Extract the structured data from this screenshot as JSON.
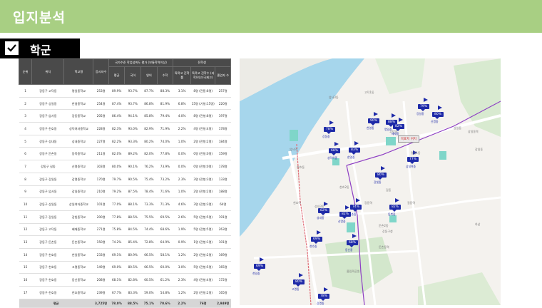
{
  "page": {
    "title": "입지분석",
    "section": "학군"
  },
  "table": {
    "head_top": [
      "순위",
      "위치",
      "학교명",
      "응시자수",
      "국가수준 학업성취도 평가 (보통학력이상)",
      "전학생",
      "",
      "",
      "",
      "진학률"
    ],
    "col_num": "순위",
    "col_loc": "위치",
    "col_school": "학교명",
    "col_takers": "응시자수",
    "col_group": "국가수준 학업성취도 평가 (보통학력이상)",
    "col_transfer": "전학생",
    "sub": [
      "평균",
      "국어",
      "영어",
      "수학",
      "특목고 진학률",
      "특목고 진학수 (과학/외고/국제고)",
      "졸업자 수"
    ],
    "rows": [
      {
        "n": "1",
        "loc": "강동구 고덕동",
        "school": "명일중학교",
        "takers": "253명",
        "avg": "89.9%",
        "kor": "93.7%",
        "eng": "87.7%",
        "math": "88.3%",
        "rate": "3.1%",
        "adv": "8명 (전통:8명)",
        "grad": "257명"
      },
      {
        "n": "2",
        "loc": "강동구 상일동",
        "school": "한영중학교",
        "takers": "254명",
        "avg": "87.4%",
        "kor": "93.7%",
        "eng": "86.8%",
        "math": "81.9%",
        "rate": "6.8%",
        "adv": "15명 (기형:15명)",
        "grad": "220명"
      },
      {
        "n": "3",
        "loc": "강동구 암사동",
        "school": "강동중학교",
        "takers": "205명",
        "avg": "86.4%",
        "kor": "94.1%",
        "eng": "85.8%",
        "math": "79.4%",
        "rate": "4.0%",
        "adv": "8명 (전형:8명)",
        "grad": "197명"
      },
      {
        "n": "4",
        "loc": "강동구 천호동",
        "school": "성덕여자중학교",
        "takers": "228명",
        "avg": "82.3%",
        "kor": "93.0%",
        "eng": "82.9%",
        "math": "71.9%",
        "rate": "2.2%",
        "adv": "4명 (전형:4명)",
        "grad": "178명"
      },
      {
        "n": "5",
        "loc": "강동구 성내동",
        "school": "성내중학교",
        "takers": "227명",
        "avg": "82.2%",
        "kor": "93.3%",
        "eng": "80.2%",
        "math": "74.0%",
        "rate": "1.0%",
        "adv": "2명 (전형:2명)",
        "grad": "184명"
      },
      {
        "n": "6",
        "loc": "강동구 둔촌동",
        "school": "동북중학교",
        "takers": "211명",
        "avg": "82.0%",
        "kor": "89.2%",
        "eng": "82.0%",
        "math": "77.8%",
        "rate": "0.0%",
        "adv": "0명 (전형:0명)",
        "grad": "159명"
      },
      {
        "n": "7",
        "loc": "강동구 길동",
        "school": "신명중학교",
        "takers": "303명",
        "avg": "80.0%",
        "kor": "90.1%",
        "eng": "76.2%",
        "math": "73.9%",
        "rate": "0.0%",
        "adv": "0명 (전형:0명)",
        "grad": "178명"
      },
      {
        "n": "8",
        "loc": "강동구 강일동",
        "school": "강명중학교",
        "takers": "170명",
        "avg": "79.7%",
        "kor": "90.5%",
        "eng": "75.4%",
        "math": "73.2%",
        "rate": "2.3%",
        "adv": "3명 (전형:3명)",
        "grad": "133명"
      },
      {
        "n": "9",
        "loc": "강동구 암사동",
        "school": "강일중학교",
        "takers": "210명",
        "avg": "79.2%",
        "kor": "87.5%",
        "eng": "78.4%",
        "math": "71.6%",
        "rate": "1.0%",
        "adv": "2명 (전형:2명)",
        "grad": "188명"
      },
      {
        "n": "10",
        "loc": "강동구 상일동",
        "school": "상일여자중학교",
        "takers": "101명",
        "avg": "77.0%",
        "kor": "88.1%",
        "eng": "73.3%",
        "math": "71.3%",
        "rate": "4.6%",
        "adv": "3명 (전형:3명)",
        "grad": "64명"
      },
      {
        "n": "11",
        "loc": "강동구 강일동",
        "school": "강빛중학교",
        "takers": "200명",
        "avg": "77.8%",
        "kor": "88.5%",
        "eng": "75.5%",
        "math": "69.5%",
        "rate": "2.6%",
        "adv": "5명 (전형:5명)",
        "grad": "191명"
      },
      {
        "n": "12",
        "loc": "강동구 고덕동",
        "school": "배재중학교",
        "takers": "271명",
        "avg": "75.8%",
        "kor": "84.5%",
        "eng": "74.4%",
        "math": "68.6%",
        "rate": "1.9%",
        "adv": "5명 (전형:5명)",
        "grad": "263명"
      },
      {
        "n": "13",
        "loc": "강동구 둔촌동",
        "school": "둔촌중학교",
        "takers": "150명",
        "avg": "74.2%",
        "kor": "85.4%",
        "eng": "72.8%",
        "math": "64.9%",
        "rate": "0.9%",
        "adv": "1명 (전형:1명)",
        "grad": "101명"
      },
      {
        "n": "14",
        "loc": "강동구 천호동",
        "school": "천일중학교",
        "takers": "233명",
        "avg": "69.1%",
        "kor": "80.9%",
        "eng": "66.5%",
        "math": "58.1%",
        "rate": "1.2%",
        "adv": "2명 (전형:2명)",
        "grad": "169명"
      },
      {
        "n": "15",
        "loc": "강동구 천호동",
        "school": "고명중학교",
        "takers": "149명",
        "avg": "69.0%",
        "kor": "80.5%",
        "eng": "66.5%",
        "math": "60.0%",
        "rate": "3.0%",
        "adv": "5명 (전형:5명)",
        "grad": "165명"
      },
      {
        "n": "16",
        "loc": "강동구 천호동",
        "school": "동신중학교",
        "takers": "208명",
        "avg": "68.1%",
        "kor": "82.8%",
        "eng": "60.5%",
        "math": "61.2%",
        "rate": "2.3%",
        "adv": "4명 (전형:4명)",
        "grad": "172명"
      },
      {
        "n": "17",
        "loc": "강동구 천호동",
        "school": "천호중학교",
        "takers": "239명",
        "avg": "67.7%",
        "kor": "83.3%",
        "eng": "59.0%",
        "math": "54.8%",
        "rate": "1.2%",
        "adv": "2명 (전형:2명)",
        "grad": "165명"
      }
    ],
    "avg_row": {
      "label": "평균",
      "takers": "3,725명",
      "avg": "78.0%",
      "kor": "88.5%",
      "eng": "75.1%",
      "math": "70.6%",
      "rate": "2.2%",
      "adv": "76명",
      "grad": "2,949명"
    }
  },
  "map": {
    "target_label": "목표지 위치",
    "markers": [
      {
        "pct": "78%",
        "name": "강동중"
      },
      {
        "pct": "90%",
        "name": "한영중"
      },
      {
        "pct": "79%",
        "name": "강일중"
      },
      {
        "pct": "88%",
        "name": "명일중"
      },
      {
        "pct": "82%",
        "name": "배재중"
      },
      {
        "pct": "68%",
        "name": "성덕여중"
      },
      {
        "pct": "83%",
        "name": "한영중"
      },
      {
        "pct": "77%",
        "name": "상일여중"
      },
      {
        "pct": "80%",
        "name": "강빛중"
      },
      {
        "pct": "69%",
        "name": "천호중"
      },
      {
        "pct": "68%",
        "name": "동신중"
      },
      {
        "pct": "80%",
        "name": "신명중"
      },
      {
        "pct": "82%",
        "name": "성내중"
      },
      {
        "pct": "82%",
        "name": "신명중"
      },
      {
        "pct": "74%",
        "name": "둔촌중"
      },
      {
        "pct": "82%",
        "name": "동북중"
      },
      {
        "pct": "69%",
        "name": "천일중"
      },
      {
        "pct": "80%",
        "name": "고명중"
      },
      {
        "pct": "78%",
        "name": "강명중"
      }
    ],
    "places": [
      "암사3동",
      "고덕1동",
      "상일동",
      "강일동",
      "명일1동",
      "천호2동",
      "천호동",
      "성내3동",
      "길동",
      "둔촌2동",
      "올림픽공원",
      "강동구청",
      "암사역",
      "천호역",
      "강동역",
      "길동역",
      "둔촌동역",
      "고덕역",
      "상일동역",
      "하남"
    ]
  }
}
